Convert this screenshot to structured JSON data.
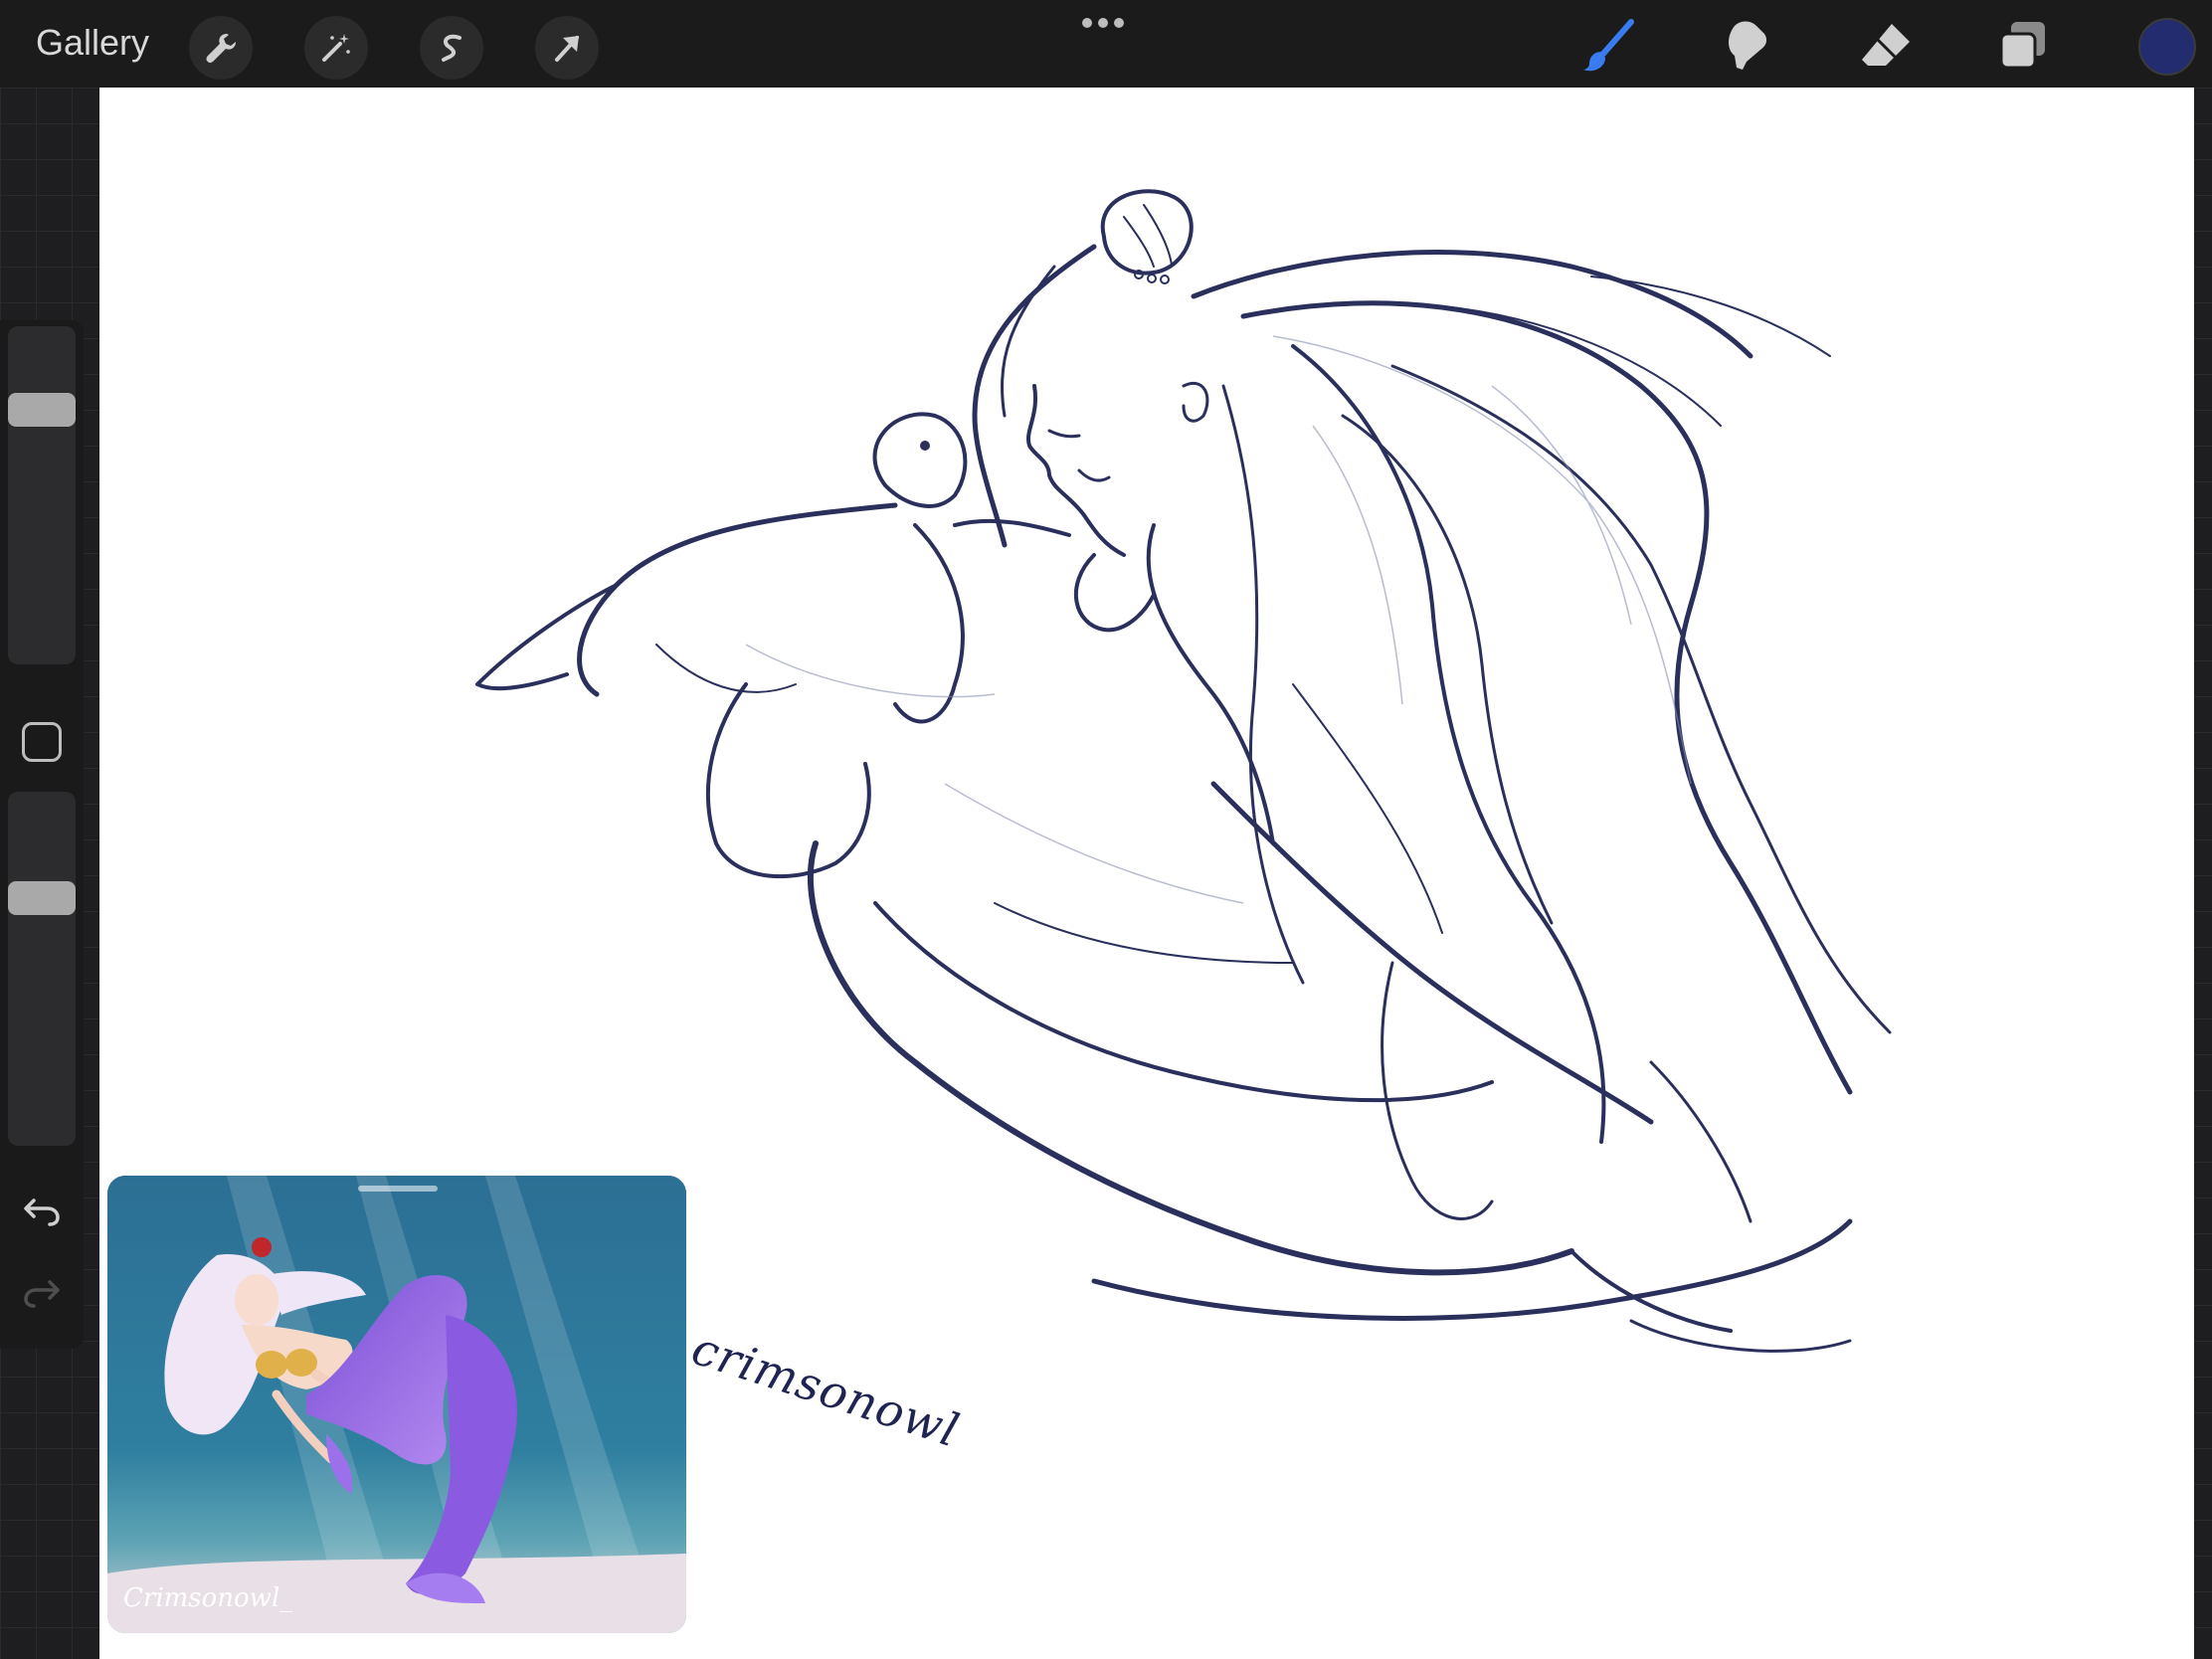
{
  "topbar": {
    "gallery_label": "Gallery",
    "left_tools": [
      "wrench-icon",
      "magic-wand-icon",
      "selection-icon",
      "transform-arrow-icon"
    ],
    "more_menu": "ellipsis-icon",
    "right_tools": [
      "brush-icon",
      "smudge-icon",
      "eraser-icon",
      "layers-icon"
    ],
    "active_tool": "brush",
    "active_color": "#232c6e",
    "accent_color": "#3a7bf0"
  },
  "sidebar": {
    "brush_size_level": 0.78,
    "brush_opacity_level": 0.72,
    "modifier_icon": "square-modifier-icon",
    "undo_icon": "undo-icon",
    "redo_icon": "redo-icon"
  },
  "canvas": {
    "signature": "crimsonowl",
    "stroke_color": "#2a2f5c"
  },
  "reference": {
    "signature": "Crimsonowl_"
  }
}
